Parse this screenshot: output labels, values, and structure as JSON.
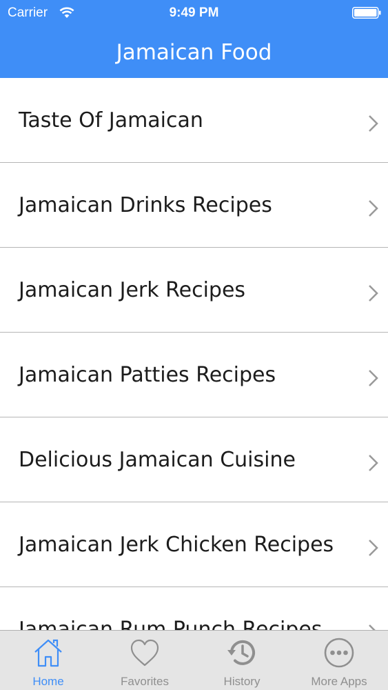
{
  "status_bar": {
    "carrier": "Carrier",
    "time": "9:49 PM"
  },
  "nav": {
    "title": "Jamaican Food"
  },
  "list": {
    "items": [
      {
        "label": "Taste Of Jamaican"
      },
      {
        "label": "Jamaican Drinks Recipes"
      },
      {
        "label": "Jamaican Jerk Recipes"
      },
      {
        "label": "Jamaican Patties Recipes"
      },
      {
        "label": "Delicious Jamaican Cuisine"
      },
      {
        "label": "Jamaican Jerk Chicken Recipes"
      },
      {
        "label": "Jamaican Rum Punch Recipes"
      }
    ]
  },
  "tab_bar": {
    "tabs": [
      {
        "label": "Home",
        "icon": "home-icon",
        "active": true
      },
      {
        "label": "Favorites",
        "icon": "heart-icon",
        "active": false
      },
      {
        "label": "History",
        "icon": "history-icon",
        "active": false
      },
      {
        "label": "More Apps",
        "icon": "more-icon",
        "active": false
      }
    ]
  },
  "colors": {
    "accent": "#3f8ef7",
    "tab_inactive": "#8f8f8f",
    "separator": "#b5b5b5",
    "tab_bar_bg": "#e4e4e4"
  }
}
